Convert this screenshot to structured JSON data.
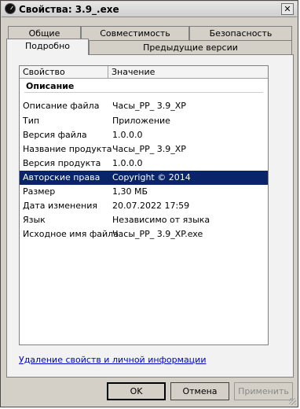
{
  "window": {
    "title": "Свойства: 3.9_.exe",
    "close_label": "✕"
  },
  "tabs_back": [
    {
      "label": "Общие"
    },
    {
      "label": "Совместимость"
    },
    {
      "label": "Безопасность"
    }
  ],
  "tabs_front": [
    {
      "label": "Подробно",
      "active": true
    },
    {
      "label": "Предыдущие версии",
      "active": false
    }
  ],
  "listview": {
    "columns": [
      "Свойство",
      "Значение"
    ],
    "group": "Описание",
    "rows": [
      {
        "key": "Описание файла",
        "value": "Часы_PP_ 3.9_XP"
      },
      {
        "key": "Тип",
        "value": "Приложение"
      },
      {
        "key": "Версия файла",
        "value": "1.0.0.0"
      },
      {
        "key": "Название продукта",
        "value": "Часы_PP_ 3.9_XP"
      },
      {
        "key": "Версия продукта",
        "value": "1.0.0.0"
      },
      {
        "key": "Авторские права",
        "value": "Copyright © 2014",
        "selected": true
      },
      {
        "key": "Размер",
        "value": "1,30 МБ"
      },
      {
        "key": "Дата изменения",
        "value": "20.07.2022 17:59"
      },
      {
        "key": "Язык",
        "value": "Независимо от языка"
      },
      {
        "key": "Исходное имя файла",
        "value": "Часы_PP_ 3.9_XP.exe"
      }
    ]
  },
  "privacy_link": "Удаление свойств и личной информации",
  "buttons": {
    "ok": "OK",
    "cancel": "Отмена",
    "apply": "Применить"
  },
  "colors": {
    "selection": "#0a246a",
    "link": "#0000cc",
    "dialog_bg": "#d4d0c8"
  }
}
